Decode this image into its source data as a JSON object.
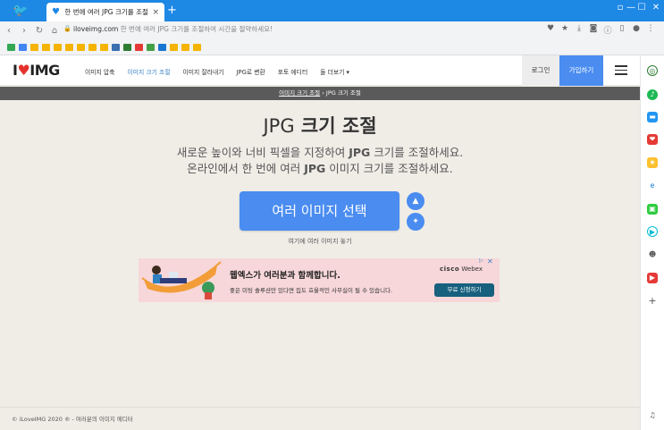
{
  "browser": {
    "tab_title": "한 번에 여러 JPG 크기를 조절하",
    "url_domain": "iloveimg.com",
    "url_title": "한 번에 여러 JPG 크기를 조절하여 시간을 절약하세요!",
    "new_tab": "+",
    "tab_close": "×",
    "win_controls": [
      "▫",
      "—",
      "☐",
      "✕"
    ]
  },
  "site": {
    "logo_pre": "I",
    "logo_heart": "♥",
    "logo_post": "IMG",
    "menu": [
      "이미지 압축",
      "이미지 크기 조절",
      "이미지 잘라내기",
      "JPG로 변환",
      "포토 에디터",
      "둘 더보기 ▾"
    ],
    "active_menu_index": 1,
    "login": "로그인",
    "signup": "가입하기"
  },
  "breadcrumb": {
    "link": "이미지 크기 조절",
    "sep": "›",
    "current": "JPG 크기 조절"
  },
  "hero": {
    "title_a": "JPG",
    "title_b": " 크기 조절",
    "sub1_a": "새로운 높이와 너비 픽셀을 지정하여 ",
    "sub1_b": "JPG",
    "sub1_c": " 크기를 조절하세요.",
    "sub2_a": "온라인에서 한 번에 여러 ",
    "sub2_b": "JPG",
    "sub2_c": " 이미지 크기를 조절하세요.",
    "select_button": "여러 이미지 선택",
    "drop_hint": "여기에 여러 이미지 놓기"
  },
  "ad": {
    "title": "웹엑스가 여러분과 함께합니다.",
    "body": "좋은 미팅 솔루션만 있다면 집도 효율적인 사무실이 될 수 있습니다.",
    "brand_a": "cisco",
    "brand_b": "Webex",
    "cta": "무료 신청하기"
  },
  "footer": {
    "text": "© iLoveIMG 2020 ® - 여러분의 이미지 에디터"
  },
  "colors": {
    "browser_blue": "#1e88e5",
    "accent_blue": "#4a8cf0",
    "logo_red": "#e5322d",
    "page_bg": "#f0ede7"
  }
}
